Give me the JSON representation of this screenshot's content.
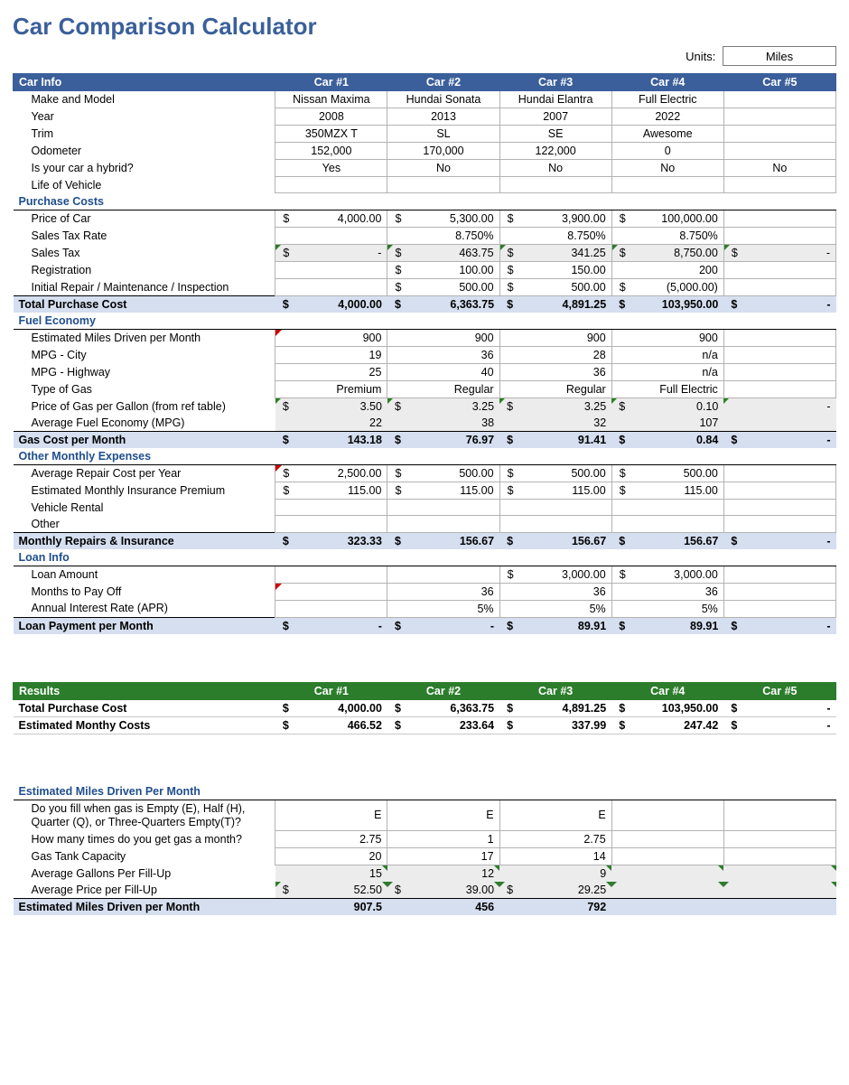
{
  "title": "Car Comparison Calculator",
  "units_label": "Units:",
  "units_value": "Miles",
  "car_headers": [
    "Car #1",
    "Car #2",
    "Car #3",
    "Car #4",
    "Car #5"
  ],
  "sec": {
    "car_info": "Car Info",
    "purchase": "Purchase Costs",
    "fuel": "Fuel Economy",
    "other": "Other Monthly Expenses",
    "loan": "Loan Info",
    "results": "Results",
    "miles": "Estimated Miles Driven Per Month"
  },
  "car_info": {
    "make_lbl": "Make and Model",
    "make": [
      "Nissan Maxima",
      "Hundai Sonata",
      "Hundai Elantra",
      "Full Electric",
      ""
    ],
    "year_lbl": "Year",
    "year": [
      "2008",
      "2013",
      "2007",
      "2022",
      ""
    ],
    "trim_lbl": "Trim",
    "trim": [
      "350MZX T",
      "SL",
      "SE",
      "Awesome",
      ""
    ],
    "odo_lbl": "Odometer",
    "odo": [
      "152,000",
      "170,000",
      "122,000",
      "0",
      ""
    ],
    "hybrid_lbl": "Is your car a hybrid?",
    "hybrid": [
      "Yes",
      "No",
      "No",
      "No",
      "No"
    ],
    "life_lbl": "Life of Vehicle",
    "life": [
      "",
      "",
      "",
      "",
      ""
    ]
  },
  "purchase": {
    "price_lbl": "Price of Car",
    "price": [
      "4,000.00",
      "5,300.00",
      "3,900.00",
      "100,000.00",
      ""
    ],
    "rate_lbl": "Sales Tax Rate",
    "rate": [
      "",
      "8.750%",
      "8.750%",
      "8.750%",
      ""
    ],
    "tax_lbl": "Sales Tax",
    "tax": [
      "-",
      "463.75",
      "341.25",
      "8,750.00",
      "-"
    ],
    "reg_lbl": "Registration",
    "reg": [
      "",
      "100.00",
      "150.00",
      "200",
      ""
    ],
    "rep_lbl": "Initial Repair / Maintenance / Inspection",
    "rep": [
      "",
      "500.00",
      "500.00",
      "(5,000.00)",
      ""
    ],
    "total_lbl": "Total Purchase Cost",
    "total": [
      "4,000.00",
      "6,363.75",
      "4,891.25",
      "103,950.00",
      "-"
    ]
  },
  "fuel": {
    "miles_lbl": "Estimated Miles Driven per Month",
    "miles": [
      "900",
      "900",
      "900",
      "900",
      ""
    ],
    "city_lbl": "MPG - City",
    "city": [
      "19",
      "36",
      "28",
      "n/a",
      ""
    ],
    "hwy_lbl": "MPG - Highway",
    "hwy": [
      "25",
      "40",
      "36",
      "n/a",
      ""
    ],
    "gas_lbl": "Type of Gas",
    "gas": [
      "Premium",
      "Regular",
      "Regular",
      "Full Electric",
      ""
    ],
    "price_lbl": "Price of Gas per Gallon (from ref table)",
    "price": [
      "3.50",
      "3.25",
      "3.25",
      "0.10",
      "-"
    ],
    "avg_lbl": "Average Fuel Economy (MPG)",
    "avg": [
      "22",
      "38",
      "32",
      "107",
      ""
    ],
    "total_lbl": "Gas Cost per Month",
    "total": [
      "143.18",
      "76.97",
      "91.41",
      "0.84",
      "-"
    ]
  },
  "other": {
    "rep_lbl": "Average Repair Cost per Year",
    "rep": [
      "2,500.00",
      "500.00",
      "500.00",
      "500.00",
      ""
    ],
    "ins_lbl": "Estimated Monthly Insurance Premium",
    "ins": [
      "115.00",
      "115.00",
      "115.00",
      "115.00",
      ""
    ],
    "rent_lbl": "Vehicle Rental",
    "rent": [
      "",
      "",
      "",
      "",
      ""
    ],
    "oth_lbl": "Other",
    "oth": [
      "",
      "",
      "",
      "",
      ""
    ],
    "total_lbl": "Monthly Repairs & Insurance",
    "total": [
      "323.33",
      "156.67",
      "156.67",
      "156.67",
      "-"
    ]
  },
  "loan": {
    "amt_lbl": "Loan Amount",
    "amt": [
      "",
      "",
      "3,000.00",
      "3,000.00",
      ""
    ],
    "mo_lbl": "Months to Pay Off",
    "mo": [
      "",
      "36",
      "36",
      "36",
      ""
    ],
    "apr_lbl": "Annual Interest Rate (APR)",
    "apr": [
      "",
      "5%",
      "5%",
      "5%",
      ""
    ],
    "total_lbl": "Loan Payment per Month",
    "total": [
      "-",
      "-",
      "89.91",
      "89.91",
      "-"
    ]
  },
  "results": {
    "tp_lbl": "Total Purchase Cost",
    "tp": [
      "4,000.00",
      "6,363.75",
      "4,891.25",
      "103,950.00",
      "-"
    ],
    "em_lbl": "Estimated Monthy Costs",
    "em": [
      "466.52",
      "233.64",
      "337.99",
      "247.42",
      "-"
    ]
  },
  "milesDriven": {
    "fill_lbl": "Do you fill when gas is Empty (E), Half (H), Quarter (Q), or Three-Quarters Empty(T)?",
    "fill": [
      "E",
      "E",
      "E",
      "",
      ""
    ],
    "times_lbl": "How many times do you get gas a month?",
    "times": [
      "2.75",
      "1",
      "2.75",
      "",
      ""
    ],
    "tank_lbl": "Gas Tank Capacity",
    "tank": [
      "20",
      "17",
      "14",
      "",
      ""
    ],
    "gal_lbl": "Average Gallons Per Fill-Up",
    "gal": [
      "15",
      "12",
      "9",
      "",
      ""
    ],
    "price_lbl": "Average Price per Fill-Up",
    "price": [
      "52.50",
      "39.00",
      "29.25",
      "",
      ""
    ],
    "total_lbl": "Estimated Miles Driven per Month",
    "total": [
      "907.5",
      "456",
      "792",
      "",
      ""
    ]
  }
}
